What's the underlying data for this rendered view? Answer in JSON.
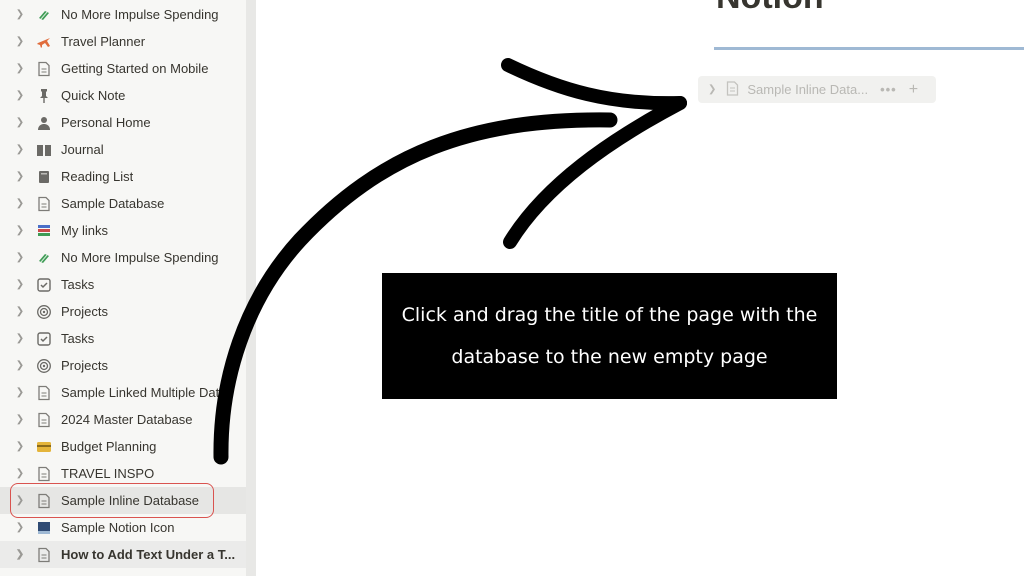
{
  "sidebar": {
    "items": [
      {
        "label": "No More Impulse Spending",
        "icon": "money-icon"
      },
      {
        "label": "Travel Planner",
        "icon": "airplane-icon"
      },
      {
        "label": "Getting Started on Mobile",
        "icon": "page-icon"
      },
      {
        "label": "Quick Note",
        "icon": "pin-icon"
      },
      {
        "label": "Personal Home",
        "icon": "person-icon"
      },
      {
        "label": "Journal",
        "icon": "book-icon"
      },
      {
        "label": "Reading List",
        "icon": "book-stack-icon"
      },
      {
        "label": "Sample Database",
        "icon": "page-icon"
      },
      {
        "label": "My links",
        "icon": "books-icon"
      },
      {
        "label": "No More Impulse Spending",
        "icon": "money-icon"
      },
      {
        "label": "Tasks",
        "icon": "checkbox-icon"
      },
      {
        "label": "Projects",
        "icon": "target-icon"
      },
      {
        "label": "Tasks",
        "icon": "checkbox-icon"
      },
      {
        "label": "Projects",
        "icon": "target-icon"
      },
      {
        "label": "Sample Linked Multiple Dat",
        "icon": "page-icon"
      },
      {
        "label": "2024 Master Database",
        "icon": "page-icon"
      },
      {
        "label": "Budget Planning",
        "icon": "credit-card-icon"
      },
      {
        "label": "TRAVEL INSPO",
        "icon": "page-icon"
      },
      {
        "label": "Sample Inline Database",
        "icon": "page-icon",
        "state": "selected"
      },
      {
        "label": "Sample Notion Icon",
        "icon": "notion-block-icon"
      },
      {
        "label": "How to Add Text Under a T...",
        "icon": "page-icon",
        "state": "active"
      }
    ]
  },
  "main": {
    "title_fragment": "Notion",
    "dragged_row": {
      "label": "Sample Inline Data...",
      "more": "•••",
      "plus": "+"
    }
  },
  "annotation": {
    "line1": "Click and drag the title of the page with the",
    "line2": "database to the new empty page"
  },
  "colors": {
    "sidebar_bg": "#f7f7f5",
    "highlight": "#d9534f",
    "title_rule": "#9fb9d4",
    "caption_bg": "#000000"
  }
}
